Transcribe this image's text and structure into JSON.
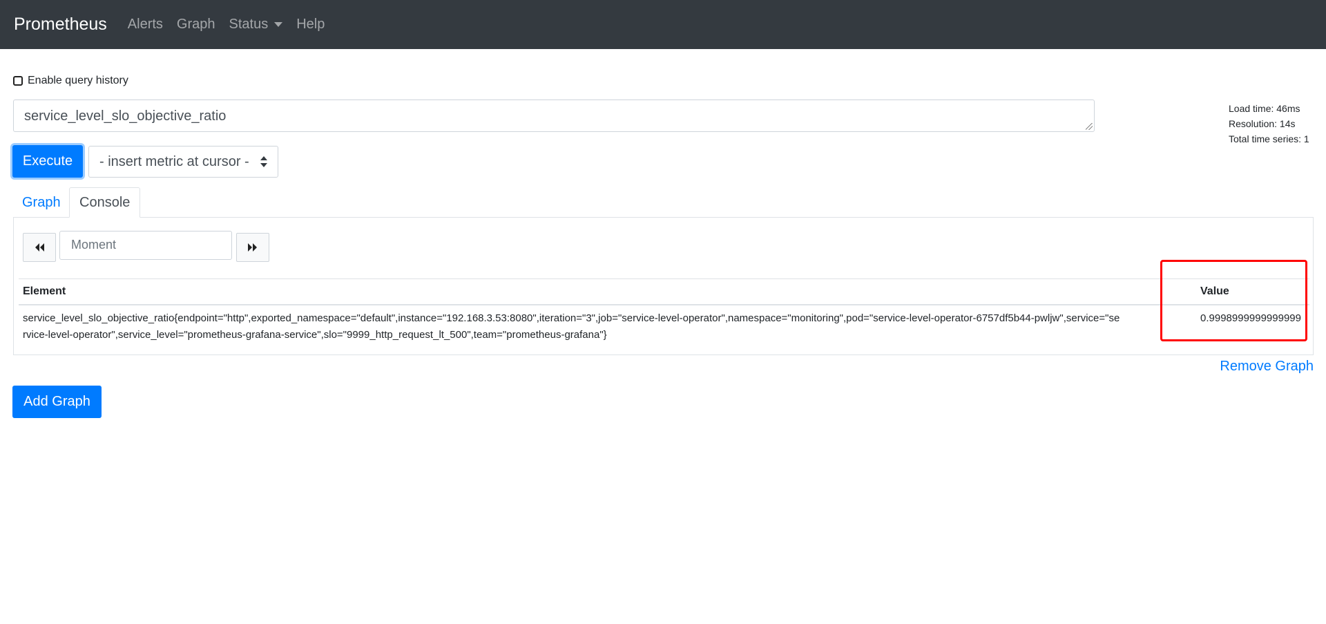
{
  "navbar": {
    "brand": "Prometheus",
    "links": [
      "Alerts",
      "Graph",
      "Status",
      "Help"
    ]
  },
  "history": {
    "label": "Enable query history",
    "checked": false
  },
  "query": {
    "expression": "service_level_slo_objective_ratio"
  },
  "stats": {
    "load_time": "Load time: 46ms",
    "resolution": "Resolution: 14s",
    "total_series": "Total time series: 1"
  },
  "controls": {
    "execute_label": "Execute",
    "metric_select": "- insert metric at cursor -"
  },
  "tabs": {
    "graph": "Graph",
    "console": "Console"
  },
  "console": {
    "moment_placeholder": "Moment",
    "back_icon": "double-chevron-left-icon",
    "forward_icon": "double-chevron-right-icon",
    "columns": {
      "element": "Element",
      "value": "Value"
    },
    "rows": [
      {
        "element": "service_level_slo_objective_ratio{endpoint=\"http\",exported_namespace=\"default\",instance=\"192.168.3.53:8080\",iteration=\"3\",job=\"service-level-operator\",namespace=\"monitoring\",pod=\"service-level-operator-6757df5b44-pwljw\",service=\"service-level-operator\",service_level=\"prometheus-grafana-service\",slo=\"9999_http_request_lt_500\",team=\"prometheus-grafana\"}",
        "value": "0.9998999999999999"
      }
    ]
  },
  "actions": {
    "remove_graph": "Remove Graph",
    "add_graph": "Add Graph"
  },
  "colors": {
    "navbar": "#343a40",
    "primary": "#007bff",
    "highlight": "#ff0000"
  }
}
